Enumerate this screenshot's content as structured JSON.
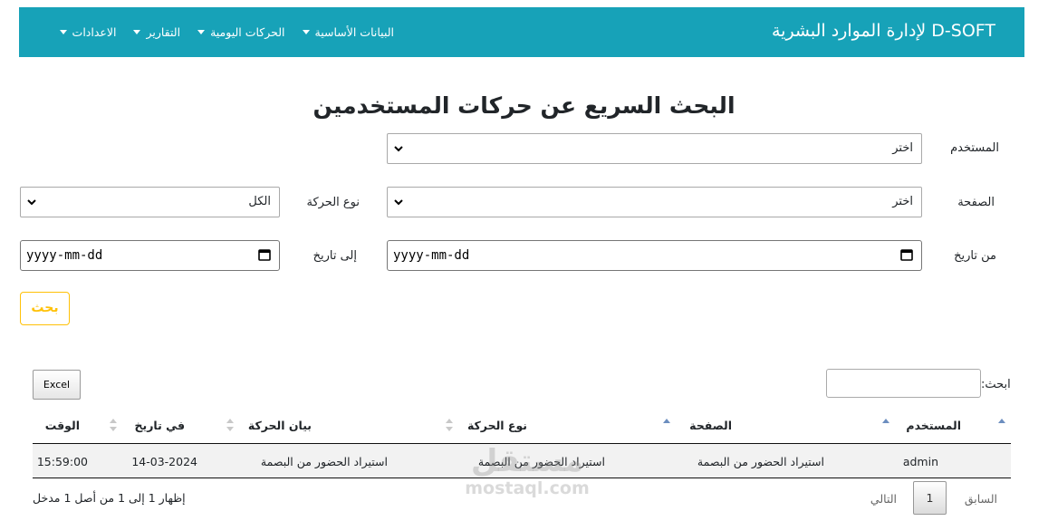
{
  "navbar": {
    "brand": "D-SOFT لإدارة الموارد البشرية",
    "menu": [
      {
        "label": "البيانات الأساسية"
      },
      {
        "label": "الحركات اليومية"
      },
      {
        "label": "التقارير"
      },
      {
        "label": "الاعدادات"
      }
    ],
    "bg_color": "#17a2b8"
  },
  "page_title": "البحث السريع عن حركات المستخدمين",
  "form": {
    "user_label": "المستخدم",
    "user_value": "اختر",
    "page_label": "الصفحة",
    "page_value": "اختر",
    "movement_type_label": "نوع الحركة",
    "movement_type_value": "الكل",
    "from_date_label": "من تاريخ",
    "from_date_value": "yyyy-mm-dd",
    "to_date_label": "إلى تاريخ",
    "to_date_value": "yyyy-mm-dd",
    "search_button": "بحث"
  },
  "table": {
    "excel_button": "Excel",
    "filter_label": "ابحث:",
    "filter_value": "",
    "columns": [
      "المستخدم",
      "الصفحة",
      "نوع الحركة",
      "بيان الحركة",
      "في تاريخ",
      "الوقت"
    ],
    "rows": [
      {
        "user": "admin",
        "page": "استيراد الحضور من البصمة",
        "movement_type": "استيراد الحضور من البصمة",
        "movement_desc": "استيراد الحضور من البصمة",
        "date": "14-03-2024",
        "time": "15:59:00"
      }
    ],
    "info": "إظهار 1 إلى 1 من أصل 1 مدخل",
    "pagination": {
      "previous": "السابق",
      "current": "1",
      "next": "التالي"
    }
  },
  "watermark": {
    "arabic": "مستقل",
    "latin": "mostaql.com"
  },
  "colors": {
    "accent": "#17a2b8",
    "warning": "#ffc107",
    "sort_active": "#6c8ebf",
    "sort_inactive": "#c8c8c8"
  }
}
